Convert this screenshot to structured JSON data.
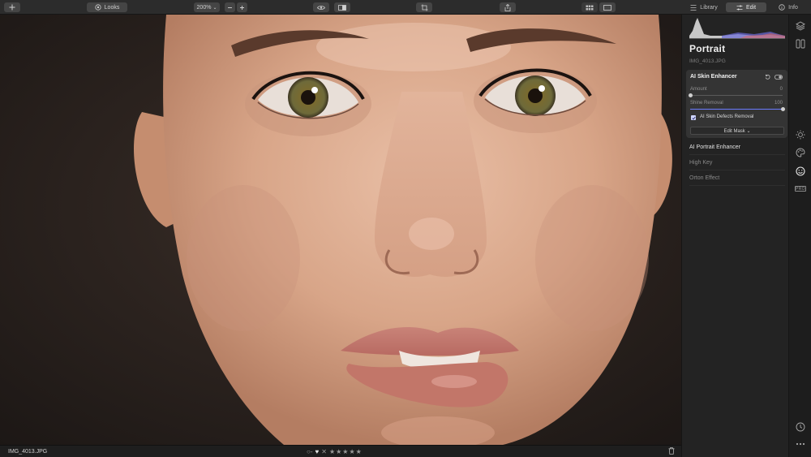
{
  "toolbar": {
    "looks_label": "Looks",
    "zoom_value": "200%",
    "zoom_chevron": "⌄",
    "tabs": [
      {
        "label": "Library"
      },
      {
        "label": "Edit"
      },
      {
        "label": "Info"
      }
    ]
  },
  "status": {
    "filename": "IMG_4013.JPG",
    "rating_stars": 5,
    "rating_filled": 0,
    "flag_glyph": "○-",
    "heart_glyph": "♥",
    "reject_glyph": "✕"
  },
  "panel": {
    "title": "Portrait",
    "filename": "IMG_4013.JPG",
    "card": {
      "title": "AI Skin Enhancer",
      "amount_label": "Amount",
      "amount_value": "0",
      "amount_level": 0,
      "shine_label": "Shine Removal",
      "shine_value": "100",
      "shine_level": 1.0,
      "checkbox_label": "AI Skin Defects Removal",
      "checkbox_checked": true,
      "mask_button": "Edit Mask ⌄"
    },
    "tools": [
      {
        "label": "AI Portrait Enhancer",
        "active": true
      },
      {
        "label": "High Key",
        "active": false
      },
      {
        "label": "Orton Effect",
        "active": false
      }
    ]
  },
  "iconcol": {
    "pro_label": "PRO",
    "icons": [
      "layers-icon",
      "compare-icon",
      "sun-icon",
      "palette-icon",
      "face-icon",
      "history-icon",
      "more-icon"
    ]
  },
  "colors": {
    "accent": "#6b7bff",
    "panel_bg": "#232323",
    "card_bg": "#343434",
    "toolbar_bg": "#2c2c2c"
  }
}
